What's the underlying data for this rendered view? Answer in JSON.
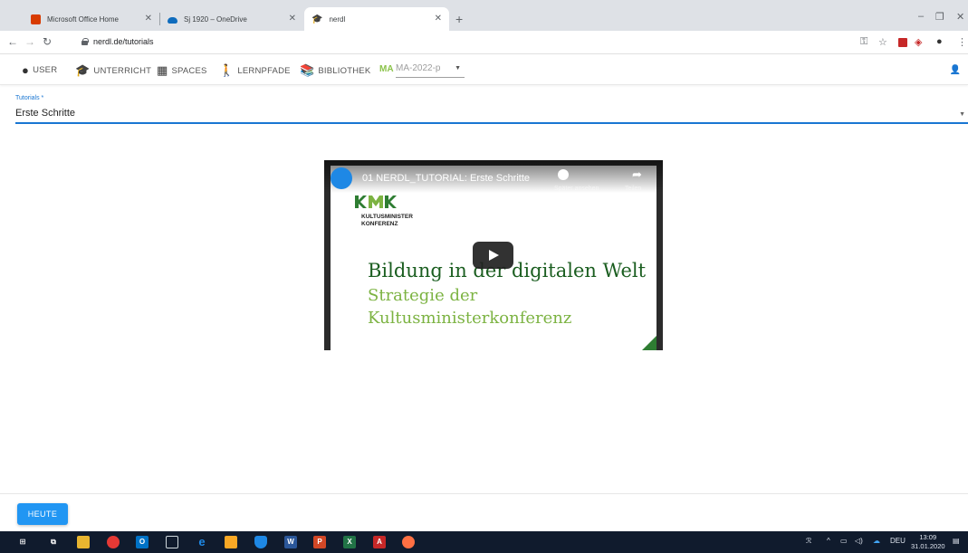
{
  "browser": {
    "tabs": [
      {
        "title": "Microsoft Office Home",
        "icon": "office-icon",
        "active": false
      },
      {
        "title": "Sj 1920 – OneDrive",
        "icon": "onedrive-icon",
        "active": false
      },
      {
        "title": "nerdl",
        "icon": "nerdl-icon",
        "active": true
      }
    ],
    "url": "nerdl.de/tutorials"
  },
  "nav": {
    "items": [
      {
        "label": "USER",
        "icon": "user-circle-icon"
      },
      {
        "label": "UNTERRICHT",
        "icon": "graduation-cap-icon"
      },
      {
        "label": "SPACES",
        "icon": "spaces-icon"
      },
      {
        "label": "LERNPFADE",
        "icon": "walking-person-icon"
      },
      {
        "label": "BIBLIOTHEK",
        "icon": "library-icon"
      }
    ],
    "ma_label": "MA",
    "class_select": "MA-2022-p"
  },
  "tutorial_select": {
    "label": "Tutorials",
    "required_mark": "*",
    "value": "Erste Schritte"
  },
  "video": {
    "title": "01 NERDL_TUTORIAL: Erste Schritte",
    "watch_later": "Später ansehen",
    "share": "Teilen",
    "slide": {
      "org_line1": "KULTUSMINISTER",
      "org_line2": "KONFERENZ",
      "headline": "Bildung in der digitalen Welt",
      "subline1": "Strategie der",
      "subline2": "Kultusministerkonferenz"
    }
  },
  "actions": {
    "today_button": "HEUTE"
  },
  "taskbar": {
    "language": "DEU",
    "time": "13:09",
    "date": "31.01.2020"
  },
  "colors": {
    "primary": "#2196f3",
    "select_underline": "#1976d2",
    "ma_green": "#8bc34a",
    "slide_dark_green": "#1b5e20",
    "slide_light_green": "#7cb342",
    "taskbar": "#101b2d"
  }
}
